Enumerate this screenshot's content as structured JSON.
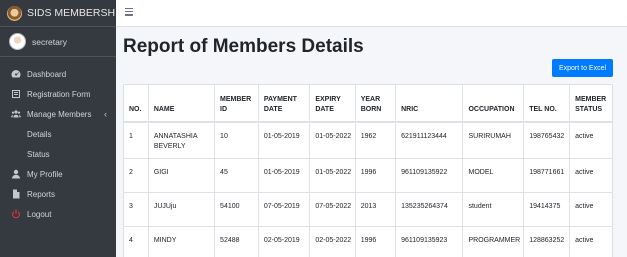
{
  "brand": {
    "name": "SIDS MEMBERSHIP"
  },
  "user": {
    "name": "secretary"
  },
  "sidebar": {
    "items": [
      {
        "label": "Dashboard",
        "icon": "dashboard-icon"
      },
      {
        "label": "Registration Form",
        "icon": "form-icon"
      },
      {
        "label": "Manage Members",
        "icon": "users-icon"
      },
      {
        "label": "Details",
        "icon": ""
      },
      {
        "label": "Status",
        "icon": ""
      },
      {
        "label": "My Profile",
        "icon": "user-icon"
      },
      {
        "label": "Reports",
        "icon": "file-icon"
      },
      {
        "label": "Logout",
        "icon": "power-icon"
      }
    ],
    "caret": "‹"
  },
  "main": {
    "title": "Report of Members Details",
    "export_label": "Export to Excel"
  },
  "table": {
    "headers": [
      "NO.",
      "NAME",
      "MEMBER ID",
      "PAYMENT DATE",
      "EXPIRY DATE",
      "YEAR BORN",
      "NRIC",
      "OCCUPATION",
      "TEL NO.",
      "MEMBER STATUS"
    ],
    "rows": [
      [
        "1",
        "ANNATASHIA BEVERLY",
        "10",
        "01-05-2019",
        "01-05-2022",
        "1962",
        "621911123444",
        "SURIRUMAH",
        "198765432",
        "active"
      ],
      [
        "2",
        "GIGI",
        "45",
        "01-05-2019",
        "01-05-2022",
        "1996",
        "961109135922",
        "MODEL",
        "198771661",
        "active"
      ],
      [
        "3",
        "JUJUju",
        "54100",
        "07-05-2019",
        "07-05-2022",
        "2013",
        "135235264374",
        "student",
        "19414375",
        "active"
      ],
      [
        "4",
        "MINDY",
        "52488",
        "02-05-2019",
        "02-05-2022",
        "1996",
        "961109135923",
        "PROGRAMMER",
        "128863252",
        "active"
      ]
    ]
  },
  "colors": {
    "sidebar": "#343a40",
    "primary": "#007bff",
    "logout": "#dc3545",
    "background": "#f4f6f9"
  }
}
